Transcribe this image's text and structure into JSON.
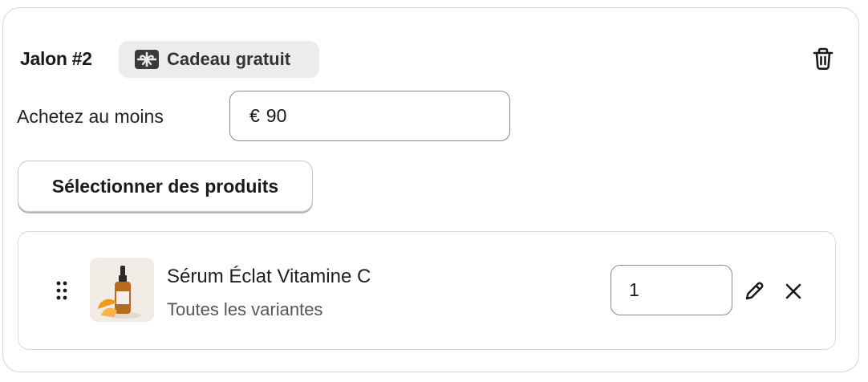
{
  "milestone": {
    "title": "Jalon #2",
    "badge": {
      "label": "Cadeau gratuit",
      "icon": "gift-icon"
    },
    "delete_icon": "trash-icon"
  },
  "min_purchase": {
    "label": "Achetez au moins",
    "currency": "€",
    "value": "90"
  },
  "select_products_label": "Sélectionner des produits",
  "product": {
    "name": "Sérum Éclat Vitamine C",
    "variants": "Toutes les variantes",
    "quantity": "1",
    "icons": {
      "drag": "drag-handle-icon",
      "edit": "pencil-icon",
      "remove": "close-icon"
    }
  }
}
